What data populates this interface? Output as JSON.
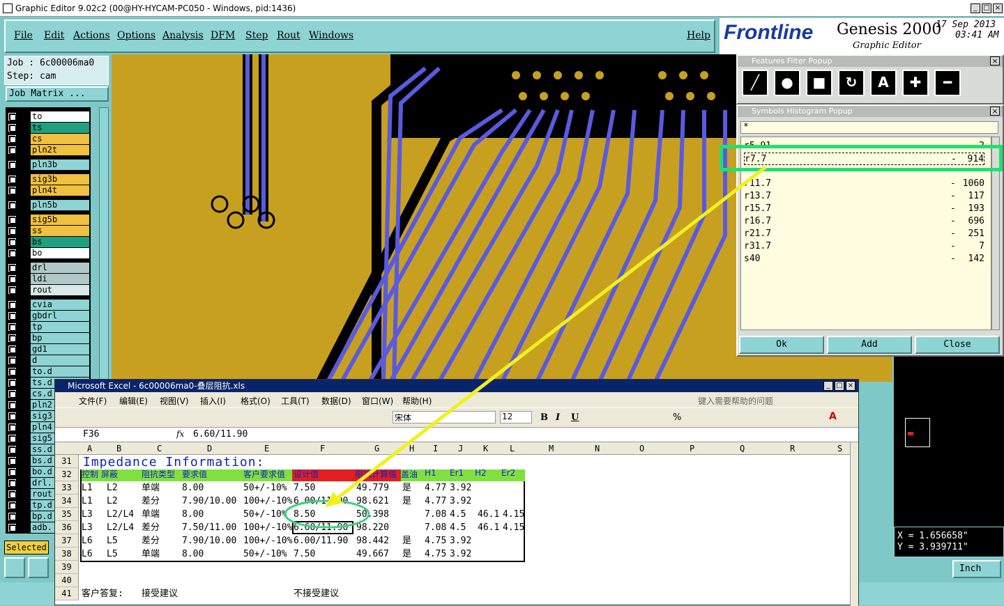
{
  "window": {
    "title": "Graphic Editor 9.02c2 (00@HY-HYCAM-PC050 - Windows, pid:1436)"
  },
  "menu": [
    "File",
    "Edit",
    "Actions",
    "Options",
    "Analysis",
    "DFM",
    "Step",
    "Rout",
    "Windows",
    "Help"
  ],
  "brand": {
    "logo": "Frontline",
    "product": "Genesis 2000",
    "subtitle": "Graphic Editor",
    "date": "17 Sep 2013",
    "time": "03:41 AM"
  },
  "job": {
    "job_line": "Job : 6c00006ma0",
    "step_line": "Step: cam",
    "matrix_button": "Job Matrix ..."
  },
  "layers": [
    {
      "name": "to",
      "color": "#ffffff"
    },
    {
      "name": "ts",
      "color": "#20a080"
    },
    {
      "name": "cs",
      "color": "#f0c040"
    },
    {
      "name": "pln2t",
      "color": "#f0c040"
    },
    {
      "name": "pln3b",
      "color": "#8ed4d4"
    },
    {
      "name": "sig3b",
      "color": "#f0c040"
    },
    {
      "name": "pln4t",
      "color": "#f0c040"
    },
    {
      "name": "pln5b",
      "color": "#8ed4d4"
    },
    {
      "name": "sig5b",
      "color": "#f0c040"
    },
    {
      "name": "ss",
      "color": "#f0c040"
    },
    {
      "name": "bs",
      "color": "#20a080"
    },
    {
      "name": "bo",
      "color": "#ffffff"
    },
    {
      "name": "drl",
      "color": "#b0c8c8"
    },
    {
      "name": "ldi",
      "color": "#b0c8c8"
    },
    {
      "name": "rout",
      "color": "#d8e8e8"
    },
    {
      "name": "cvia",
      "color": "#8ed4d4"
    },
    {
      "name": "gbdrl",
      "color": "#8ed4d4"
    },
    {
      "name": "tp",
      "color": "#8ed4d4"
    },
    {
      "name": "bp",
      "color": "#8ed4d4"
    },
    {
      "name": "gd1",
      "color": "#8ed4d4"
    },
    {
      "name": "d",
      "color": "#8ed4d4"
    },
    {
      "name": "to.d",
      "color": "#8ed4d4"
    },
    {
      "name": "ts.d",
      "color": "#8ed4d4"
    },
    {
      "name": "cs.d",
      "color": "#8ed4d4"
    },
    {
      "name": "pln2",
      "color": "#8ed4d4"
    },
    {
      "name": "sig3",
      "color": "#8ed4d4"
    },
    {
      "name": "pln4",
      "color": "#8ed4d4"
    },
    {
      "name": "sig5",
      "color": "#8ed4d4"
    },
    {
      "name": "ss.d",
      "color": "#8ed4d4"
    },
    {
      "name": "bs.d",
      "color": "#8ed4d4"
    },
    {
      "name": "bo.d",
      "color": "#8ed4d4"
    },
    {
      "name": "drl.",
      "color": "#8ed4d4"
    },
    {
      "name": "rout",
      "color": "#8ed4d4"
    },
    {
      "name": "tp.d",
      "color": "#8ed4d4"
    },
    {
      "name": "bp.d",
      "color": "#8ed4d4"
    },
    {
      "name": "adb.",
      "color": "#8ed4d4"
    }
  ],
  "selected_label": "Selected",
  "features_popup": {
    "title": "Features Filter Popup"
  },
  "symbols_popup": {
    "title": "Symbols Histogram Popup",
    "filter": "*",
    "rows": [
      {
        "sym": "r5.91",
        "cnt": "2"
      },
      {
        "sym": "r7.7",
        "cnt": "914"
      },
      {
        "sym": "r11.7",
        "cnt": "1060"
      },
      {
        "sym": "r13.7",
        "cnt": "117"
      },
      {
        "sym": "r15.7",
        "cnt": "193"
      },
      {
        "sym": "r16.7",
        "cnt": "696"
      },
      {
        "sym": "r21.7",
        "cnt": "251"
      },
      {
        "sym": "r31.7",
        "cnt": "7"
      },
      {
        "sym": "s40",
        "cnt": "142"
      }
    ],
    "buttons": {
      "ok": "Ok",
      "add": "Add",
      "close": "Close"
    }
  },
  "coords": {
    "x": "X = 1.656658\"",
    "y": "Y = 3.939711\""
  },
  "units": "Inch",
  "excel": {
    "title": "Microsoft Excel - 6c00006ma0-叠层阻抗.xls",
    "menu": [
      "文件(F)",
      "编辑(E)",
      "视图(V)",
      "插入(I)",
      "格式(O)",
      "工具(T)",
      "数据(D)",
      "窗口(W)",
      "帮助(H)"
    ],
    "help_placeholder": "键入需要帮助的问题",
    "font_name": "宋体",
    "font_size": "12",
    "namebox": "F36",
    "formula": "6.60/11.90",
    "columns": [
      "A",
      "B",
      "C",
      "D",
      "E",
      "F",
      "G",
      "H",
      "I",
      "J",
      "K",
      "L",
      "M",
      "N",
      "O",
      "P",
      "Q",
      "R",
      "S"
    ],
    "row_numbers": [
      "31",
      "32",
      "33",
      "34",
      "35",
      "36",
      "37",
      "38",
      "39",
      "40",
      "41"
    ],
    "heading": "Impedance Information:",
    "header_row": [
      "控制",
      "屏蔽",
      "阻抗类型",
      "要求值",
      "客户要求值",
      "设计值",
      "阻抗计算值",
      "盖油",
      "H1",
      "Er1",
      "H2",
      "Er2"
    ],
    "rows": [
      [
        "L1",
        "L2",
        "单端",
        "8.00",
        "50+/-10%",
        "7.50",
        "49.779",
        "是",
        "4.77",
        "3.92",
        "",
        ""
      ],
      [
        "L1",
        "L2",
        "差分",
        "7.90/10.00",
        "100+/-10%",
        "6.00/11.90",
        "98.621",
        "是",
        "4.77",
        "3.92",
        "",
        ""
      ],
      [
        "L3",
        "L2/L4",
        "单端",
        "8.00",
        "50+/-10%",
        "8.50",
        "50.398",
        "",
        "7.08",
        "4.5",
        "46.1",
        "4.15"
      ],
      [
        "L3",
        "L2/L4",
        "差分",
        "7.50/11.00",
        "100+/-10%",
        "6.60/11.90",
        "98.220",
        "",
        "7.08",
        "4.5",
        "46.1",
        "4.15"
      ],
      [
        "L6",
        "L5",
        "差分",
        "7.90/10.00",
        "100+/-10%",
        "6.00/11.90",
        "98.442",
        "是",
        "4.75",
        "3.92",
        "",
        ""
      ],
      [
        "L6",
        "L5",
        "单端",
        "8.00",
        "50+/-10%",
        "7.50",
        "49.667",
        "是",
        "4.75",
        "3.92",
        "",
        ""
      ]
    ],
    "footer": {
      "label": "客户答复:",
      "opt1": "接受建议",
      "opt2": "不接受建议"
    }
  }
}
